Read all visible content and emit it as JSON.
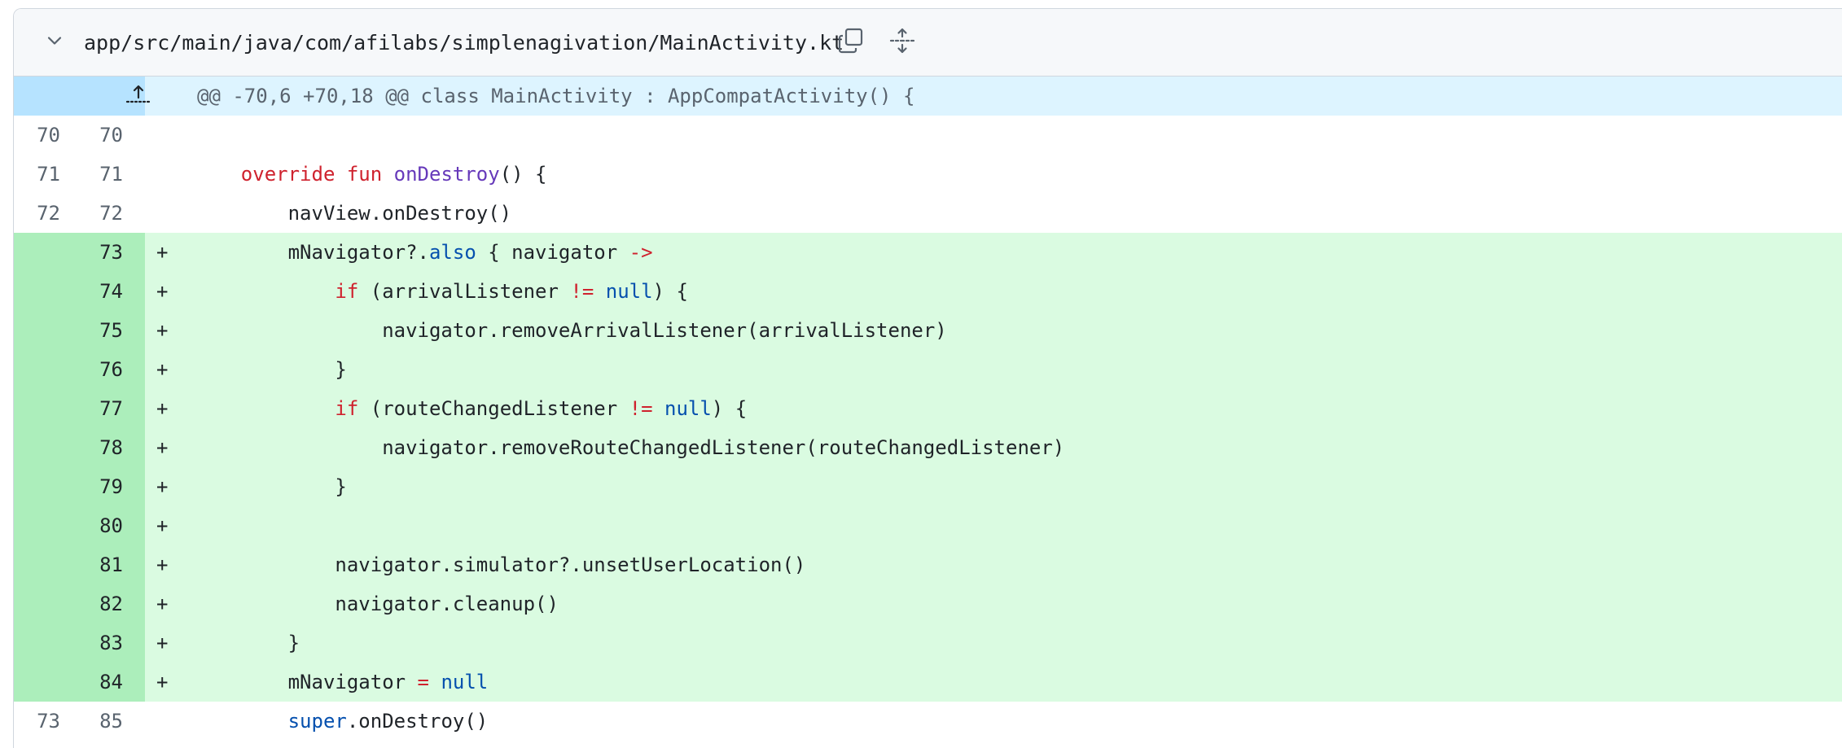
{
  "file": {
    "path": "app/src/main/java/com/afilabs/simplenagivation/MainActivity.kt"
  },
  "hunk": {
    "header": "@@ -70,6 +70,18 @@ class MainActivity : AppCompatActivity() {"
  },
  "lines": [
    {
      "type": "ctx",
      "old": "70",
      "new": "70",
      "marker": "",
      "tokens": [
        {
          "t": "",
          "c": ""
        }
      ]
    },
    {
      "type": "ctx",
      "old": "71",
      "new": "71",
      "marker": "",
      "tokens": [
        {
          "t": "    ",
          "c": ""
        },
        {
          "t": "override",
          "c": "kw"
        },
        {
          "t": " ",
          "c": ""
        },
        {
          "t": "fun",
          "c": "kw"
        },
        {
          "t": " ",
          "c": ""
        },
        {
          "t": "onDestroy",
          "c": "fn"
        },
        {
          "t": "() {",
          "c": ""
        }
      ]
    },
    {
      "type": "ctx",
      "old": "72",
      "new": "72",
      "marker": "",
      "tokens": [
        {
          "t": "        navView.onDestroy()",
          "c": ""
        }
      ]
    },
    {
      "type": "add",
      "old": "",
      "new": "73",
      "marker": "+",
      "tokens": [
        {
          "t": "        mNavigator?.",
          "c": ""
        },
        {
          "t": "also",
          "c": "nl"
        },
        {
          "t": " { navigator ",
          "c": ""
        },
        {
          "t": "->",
          "c": "op"
        }
      ]
    },
    {
      "type": "add",
      "old": "",
      "new": "74",
      "marker": "+",
      "tokens": [
        {
          "t": "            ",
          "c": ""
        },
        {
          "t": "if",
          "c": "kw"
        },
        {
          "t": " (arrivalListener ",
          "c": ""
        },
        {
          "t": "!=",
          "c": "op"
        },
        {
          "t": " ",
          "c": ""
        },
        {
          "t": "null",
          "c": "nl"
        },
        {
          "t": ") {",
          "c": ""
        }
      ]
    },
    {
      "type": "add",
      "old": "",
      "new": "75",
      "marker": "+",
      "tokens": [
        {
          "t": "                navigator.removeArrivalListener(arrivalListener)",
          "c": ""
        }
      ]
    },
    {
      "type": "add",
      "old": "",
      "new": "76",
      "marker": "+",
      "tokens": [
        {
          "t": "            }",
          "c": ""
        }
      ]
    },
    {
      "type": "add",
      "old": "",
      "new": "77",
      "marker": "+",
      "tokens": [
        {
          "t": "            ",
          "c": ""
        },
        {
          "t": "if",
          "c": "kw"
        },
        {
          "t": " (routeChangedListener ",
          "c": ""
        },
        {
          "t": "!=",
          "c": "op"
        },
        {
          "t": " ",
          "c": ""
        },
        {
          "t": "null",
          "c": "nl"
        },
        {
          "t": ") {",
          "c": ""
        }
      ]
    },
    {
      "type": "add",
      "old": "",
      "new": "78",
      "marker": "+",
      "tokens": [
        {
          "t": "                navigator.removeRouteChangedListener(routeChangedListener)",
          "c": ""
        }
      ]
    },
    {
      "type": "add",
      "old": "",
      "new": "79",
      "marker": "+",
      "tokens": [
        {
          "t": "            }",
          "c": ""
        }
      ]
    },
    {
      "type": "add",
      "old": "",
      "new": "80",
      "marker": "+",
      "tokens": [
        {
          "t": "",
          "c": ""
        }
      ]
    },
    {
      "type": "add",
      "old": "",
      "new": "81",
      "marker": "+",
      "tokens": [
        {
          "t": "            navigator.simulator?.unsetUserLocation()",
          "c": ""
        }
      ]
    },
    {
      "type": "add",
      "old": "",
      "new": "82",
      "marker": "+",
      "tokens": [
        {
          "t": "            navigator.cleanup()",
          "c": ""
        }
      ]
    },
    {
      "type": "add",
      "old": "",
      "new": "83",
      "marker": "+",
      "tokens": [
        {
          "t": "        }",
          "c": ""
        }
      ]
    },
    {
      "type": "add",
      "old": "",
      "new": "84",
      "marker": "+",
      "tokens": [
        {
          "t": "        mNavigator ",
          "c": ""
        },
        {
          "t": "=",
          "c": "op"
        },
        {
          "t": " ",
          "c": ""
        },
        {
          "t": "null",
          "c": "nl"
        }
      ]
    },
    {
      "type": "ctx",
      "old": "73",
      "new": "85",
      "marker": "",
      "tokens": [
        {
          "t": "        ",
          "c": ""
        },
        {
          "t": "super",
          "c": "nl"
        },
        {
          "t": ".onDestroy()",
          "c": ""
        }
      ]
    }
  ],
  "colors": {
    "addition_bg": "#dafbe1",
    "addition_gutter": "#aceebb",
    "hunk_bg": "#ddf4ff",
    "hunk_gutter": "#b6e3ff",
    "keyword": "#cf222e",
    "function": "#6639ba",
    "literal": "#0550ae"
  },
  "icons": {
    "collapse": "chevron-down-icon",
    "copy": "copy-icon",
    "expand_all": "unfold-icon",
    "expand_up": "fold-up-icon"
  }
}
